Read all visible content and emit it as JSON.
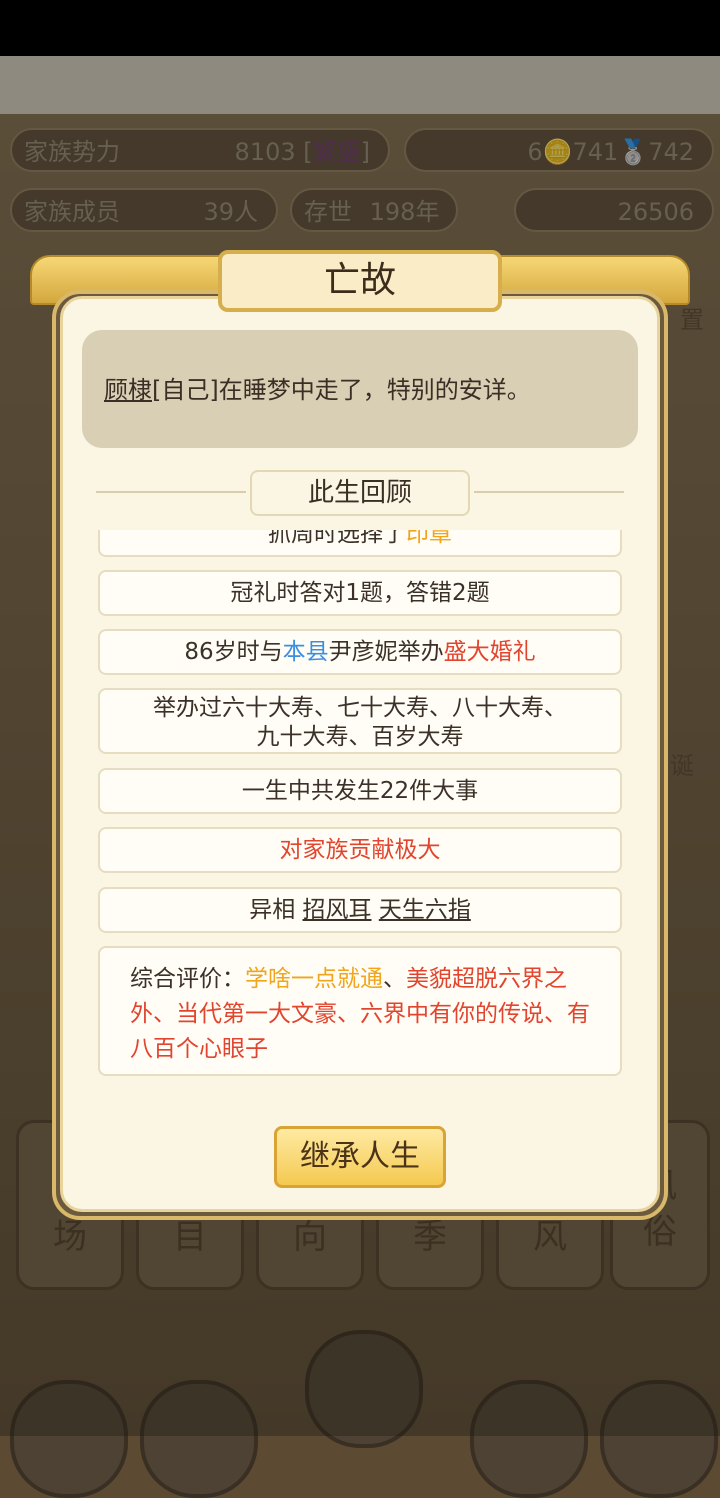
{
  "hud": {
    "family_power_label": "家族势力",
    "family_power_value": "8103 [",
    "family_power_rank": "繁盛",
    "family_power_close": "]",
    "resources": "6🪙741🥈742",
    "members_label": "家族成员",
    "members_value": "39人",
    "survive_label": "存世",
    "survive_value": "198年",
    "gold_value": "26506",
    "side_right": "置",
    "side_right2": "诞"
  },
  "bottom_buttons": [
    "场",
    "目",
    "向",
    "季",
    "风",
    "风\n俗"
  ],
  "modal": {
    "title": "亡故",
    "message_name": "顾棣",
    "message_rest": "[自己]在睡梦中走了，特别的安详。",
    "review_title": "此生回顾",
    "cut_item": "抓周时选择了",
    "cut_item_highlight": "印章",
    "items": {
      "coming_of_age": "冠礼时答对1题，答错2题",
      "marriage_pre": "86岁时与",
      "marriage_place": "本县",
      "marriage_mid": "尹彦妮举办",
      "marriage_event": "盛大婚礼",
      "birthdays_line1": "举办过六十大寿、七十大寿、八十大寿、",
      "birthdays_line2": "九十大寿、百岁大寿",
      "events": "一生中共发生22件大事",
      "contribution": "对家族贡献极大",
      "traits_label": "异相",
      "trait1": "招风耳",
      "trait2": "天生六指",
      "eval_label": "综合评价：",
      "eval1": "学啥一点就通",
      "eval_sep1": "、",
      "eval2": "美貌超脱六界之外、当代第一大文豪、六界中有你的传说、有八百个心眼子"
    },
    "inherit_button": "继承人生"
  },
  "colors": {
    "accent_gold": "#f4c94f",
    "highlight_orange": "#f0a51c",
    "highlight_red": "#e2452f",
    "highlight_blue": "#3b8ee0"
  }
}
